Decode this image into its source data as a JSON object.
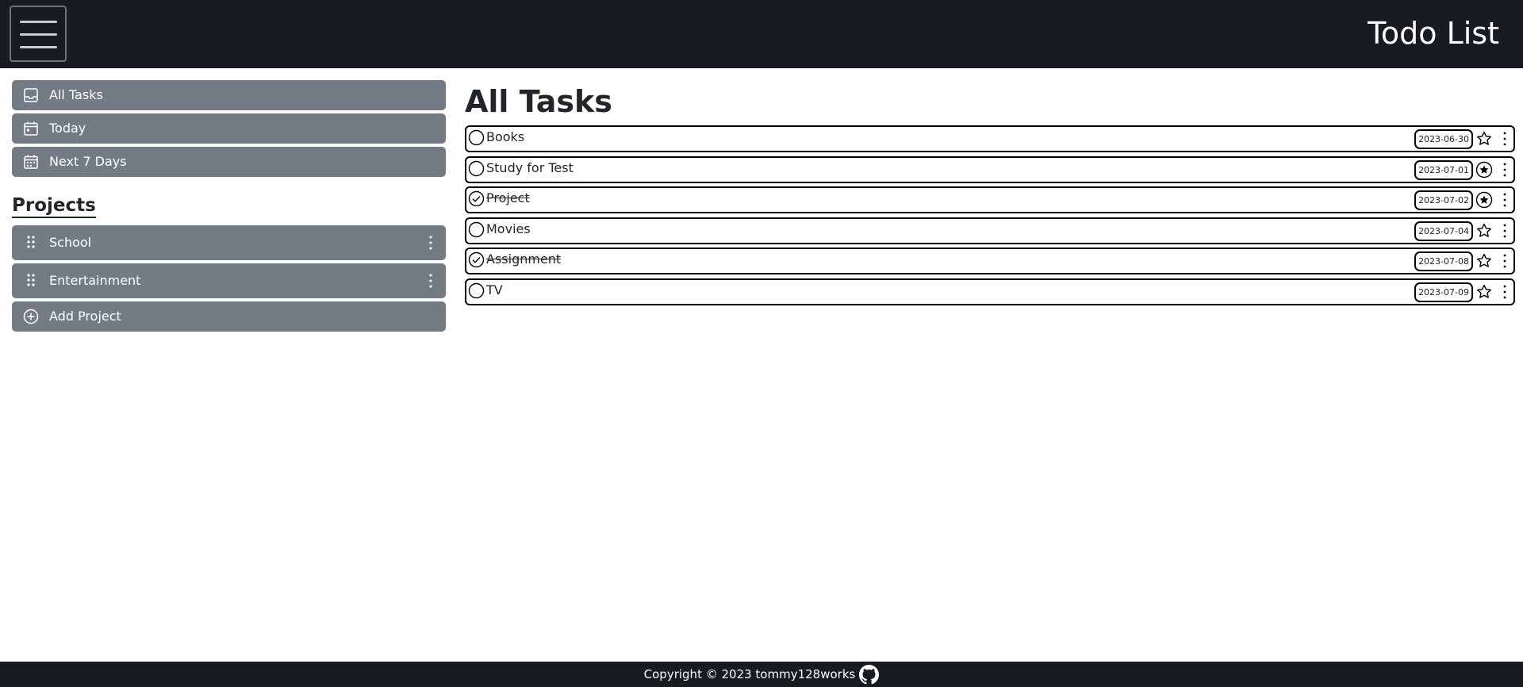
{
  "header": {
    "title": "Todo List",
    "menu_icon": "hamburger-icon"
  },
  "sidebar": {
    "nav": [
      {
        "label": "All Tasks",
        "icon": "inbox-icon"
      },
      {
        "label": "Today",
        "icon": "calendar-today-icon"
      },
      {
        "label": "Next 7 Days",
        "icon": "calendar-week-icon"
      }
    ],
    "projects_heading": "Projects",
    "projects": [
      {
        "label": "School",
        "icon": "drag-handle-icon"
      },
      {
        "label": "Entertainment",
        "icon": "drag-handle-icon"
      }
    ],
    "add_project_label": "Add Project"
  },
  "main": {
    "title": "All Tasks",
    "tasks": [
      {
        "name": "Books",
        "date": "2023-06-30",
        "completed": false,
        "starred": false
      },
      {
        "name": "Study for Test",
        "date": "2023-07-01",
        "completed": false,
        "starred": true
      },
      {
        "name": "Project",
        "date": "2023-07-02",
        "completed": true,
        "starred": true
      },
      {
        "name": "Movies",
        "date": "2023-07-04",
        "completed": false,
        "starred": false
      },
      {
        "name": "Assignment",
        "date": "2023-07-08",
        "completed": true,
        "starred": false
      },
      {
        "name": "TV",
        "date": "2023-07-09",
        "completed": false,
        "starred": false
      }
    ]
  },
  "footer": {
    "copyright": "Copyright © 2023 tommy128works",
    "icon": "github-icon"
  },
  "colors": {
    "header_bg": "#181b1f",
    "sidebar_item_bg": "#737b84",
    "text": "#212529"
  }
}
